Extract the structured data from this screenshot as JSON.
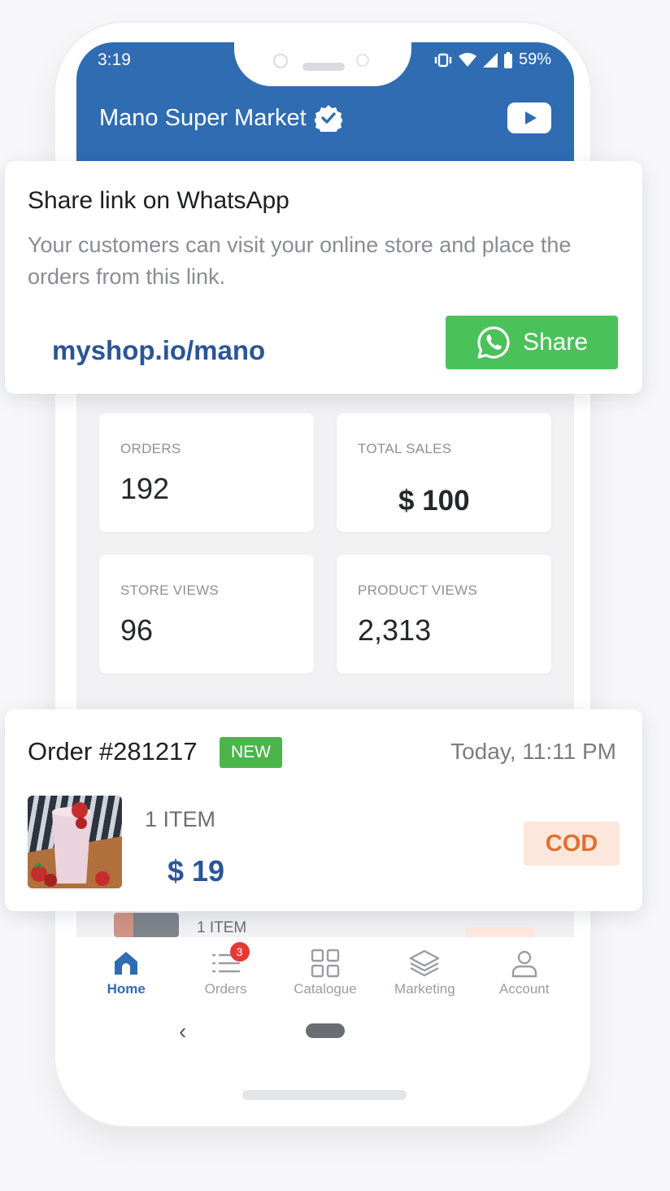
{
  "status_bar": {
    "time": "3:19",
    "battery": "59%"
  },
  "header": {
    "store_name": "Mano Super Market"
  },
  "share_card": {
    "title": "Share link on WhatsApp",
    "description": "Your customers can visit your online store and place the orders from this link.",
    "link": "myshop.io/mano",
    "button_label": "Share"
  },
  "stats": [
    {
      "label": "ORDERS",
      "value": "192"
    },
    {
      "label": "TOTAL SALES",
      "value": "$ 100"
    },
    {
      "label": "STORE VIEWS",
      "value": "96"
    },
    {
      "label": "PRODUCT VIEWS",
      "value": "2,313"
    }
  ],
  "order": {
    "title": "Order #281217",
    "badge": "NEW",
    "time": "Today, 11:11 PM",
    "items": "1 ITEM",
    "price": "$ 19",
    "payment": "COD"
  },
  "ghost_order": {
    "items": "1 ITEM"
  },
  "nav": [
    {
      "label": "Home",
      "icon": "home-icon",
      "active": true
    },
    {
      "label": "Orders",
      "icon": "orders-list-icon",
      "badge": "3"
    },
    {
      "label": "Catalogue",
      "icon": "grid-icon"
    },
    {
      "label": "Marketing",
      "icon": "layers-icon"
    },
    {
      "label": "Account",
      "icon": "person-icon"
    }
  ],
  "colors": {
    "brand_blue": "#2f6cb2",
    "whatsapp_green": "#4bc15a",
    "new_badge_green": "#4bb54a",
    "cod_orange": "#e3702d",
    "cod_bg": "#fde7dd",
    "link_blue": "#2a5597"
  }
}
